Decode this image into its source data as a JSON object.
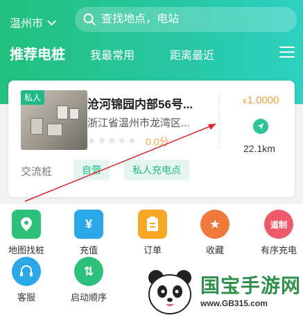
{
  "header": {
    "city": "温州市",
    "search_placeholder": "查找地点，电站",
    "tabs": [
      {
        "label": "推荐电桩",
        "active": true
      },
      {
        "label": "我最常用",
        "active": false
      },
      {
        "label": "距离最近",
        "active": false
      }
    ],
    "menu_icon": "list-icon"
  },
  "station": {
    "tag": "私人",
    "title": "沧河锦园内部56号...",
    "address": "浙江省温州市龙湾区...",
    "rating": 0,
    "score_label": "0.0分",
    "price_symbol": "¥",
    "price": "1.0000",
    "distance": "22.1km",
    "charger_type": "交流桩",
    "chips": [
      "自营",
      "私人充电点"
    ]
  },
  "grid": [
    {
      "label": "地图找桩",
      "icon": "map-pin-icon",
      "color": "#2cc07a"
    },
    {
      "label": "充值",
      "icon": "yen-icon",
      "color": "#2aa7e6"
    },
    {
      "label": "订单",
      "icon": "clipboard-icon",
      "color": "#f5a623"
    },
    {
      "label": "收藏",
      "icon": "star-icon",
      "color": "#f07a3c"
    },
    {
      "label": "有序充电",
      "icon": "ordered-charge-icon",
      "color": "#ef5a6b",
      "icon_text": "道制"
    },
    {
      "label": "客服",
      "icon": "headset-icon",
      "color": "#2aa7e6"
    },
    {
      "label": "启动顺序",
      "icon": "up-down-icon",
      "color": "#2cc07a"
    }
  ],
  "watermark": {
    "text": "国宝手游网",
    "url": "www.GB315.com"
  },
  "colors": {
    "brand_green": "#1fb985",
    "price_orange": "#e4a13a",
    "annotation_red": "#d9282e"
  }
}
